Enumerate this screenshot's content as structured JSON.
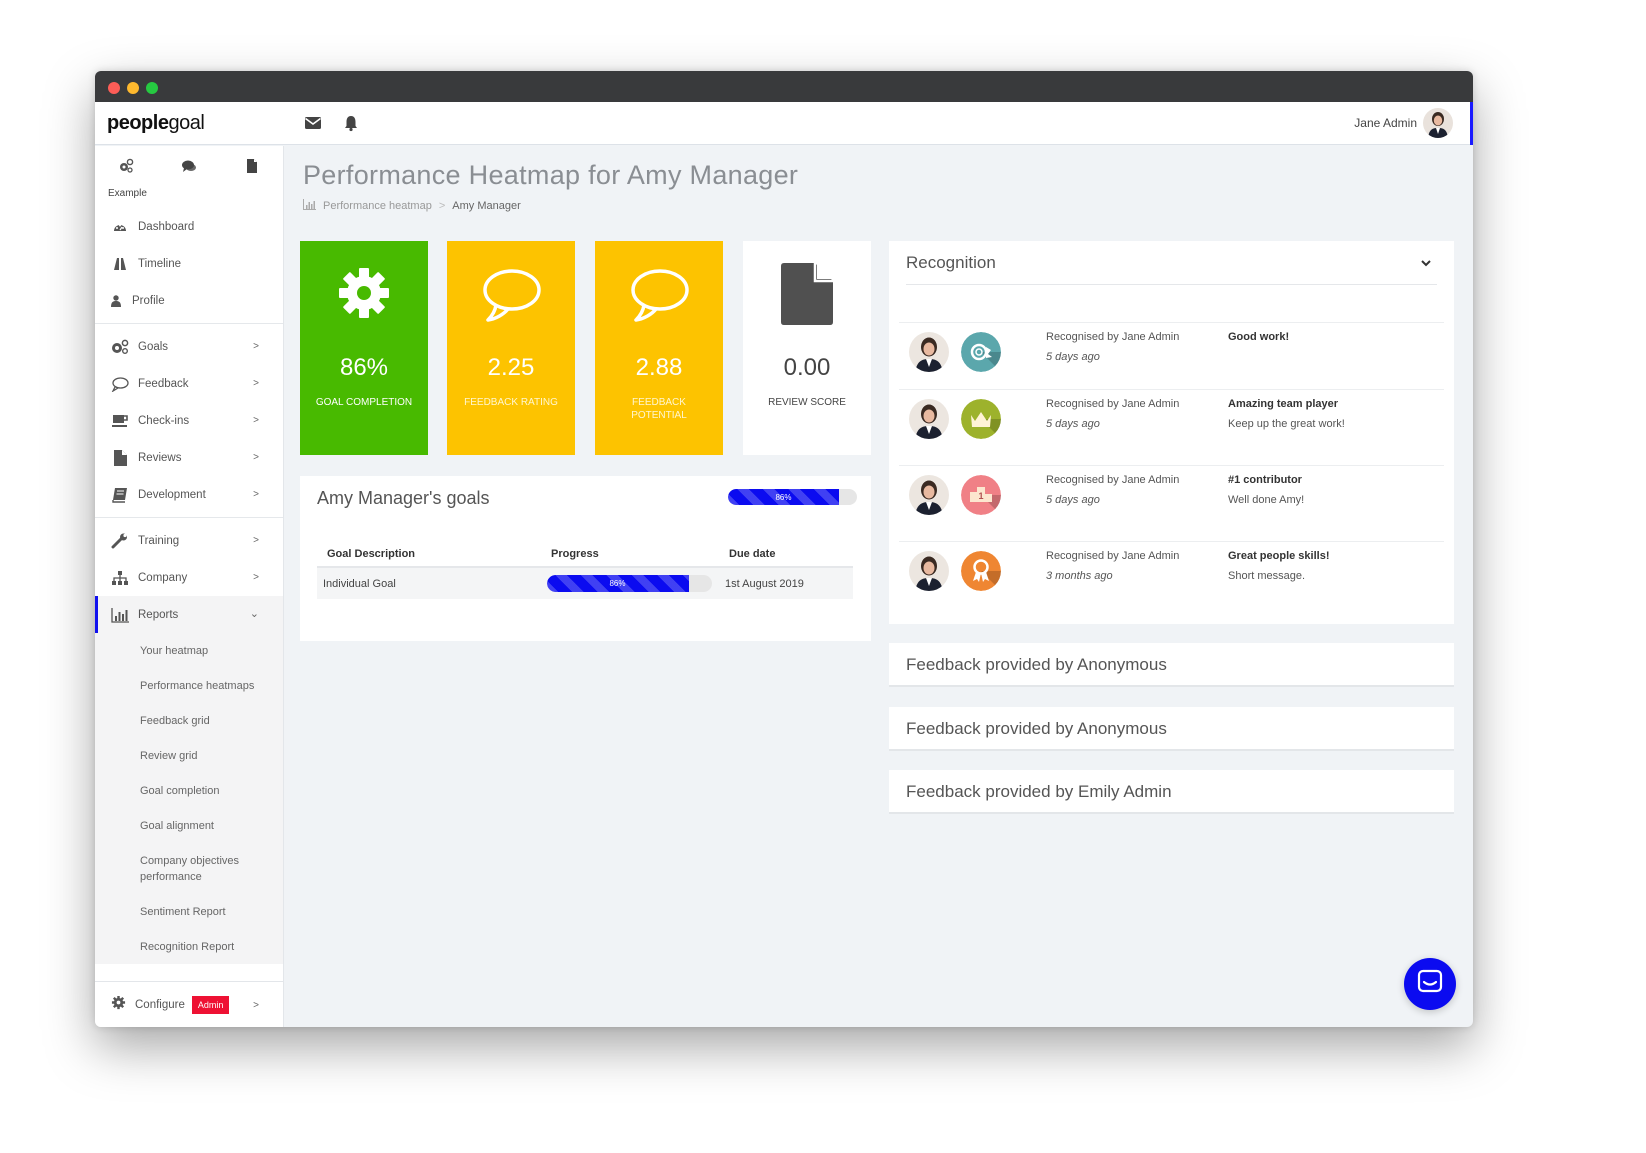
{
  "app": {
    "logo_bold": "people",
    "logo_light": "goal",
    "user_name": "Jane Admin"
  },
  "sidebar": {
    "org_label": "Example",
    "top_items": [
      {
        "label": "Dashboard",
        "icon": "dashboard-icon"
      },
      {
        "label": "Timeline",
        "icon": "road-icon"
      },
      {
        "label": "Profile",
        "icon": "user-icon"
      }
    ],
    "section_items": [
      {
        "label": "Goals",
        "icon": "cogs-icon"
      },
      {
        "label": "Feedback",
        "icon": "speech-bubble-icon"
      },
      {
        "label": "Check-ins",
        "icon": "coffee-cup-icon"
      },
      {
        "label": "Reviews",
        "icon": "document-icon"
      },
      {
        "label": "Development",
        "icon": "book-icon"
      }
    ],
    "lower_items": [
      {
        "label": "Training",
        "icon": "wrench-icon"
      },
      {
        "label": "Company",
        "icon": "org-chart-icon"
      }
    ],
    "reports": {
      "label": "Reports",
      "sub_items": [
        "Your heatmap",
        "Performance heatmaps",
        "Feedback grid",
        "Review grid",
        "Goal completion",
        "Goal alignment",
        "Company objectives performance",
        "Sentiment Report",
        "Recognition Report"
      ]
    },
    "configure": {
      "label": "Configure",
      "badge": "Admin"
    }
  },
  "page": {
    "title": "Performance Heatmap for Amy Manager",
    "breadcrumb": {
      "parent": "Performance heatmap",
      "separator": ">",
      "current": "Amy Manager"
    }
  },
  "tiles": [
    {
      "value": "86%",
      "label": "GOAL COMPLETION",
      "color": "#48ba00",
      "icon": "gear-icon"
    },
    {
      "value": "2.25",
      "label": "FEEDBACK RATING",
      "color": "#fdc300",
      "icon": "speech-bubble-icon"
    },
    {
      "value": "2.88",
      "label": "FEEDBACK POTENTIAL",
      "color": "#fdc300",
      "icon": "speech-bubble-icon"
    },
    {
      "value": "0.00",
      "label": "REVIEW SCORE",
      "color": "#ffffff",
      "icon": "document-icon"
    }
  ],
  "goals": {
    "title": "Amy Manager's goals",
    "overall_progress": 86,
    "overall_progress_label": "86%",
    "columns": [
      "Goal Description",
      "Progress",
      "Due date"
    ],
    "rows": [
      {
        "description": "Individual Goal",
        "progress": 86,
        "progress_label": "86%",
        "due": "1st August 2019"
      }
    ]
  },
  "recognition": {
    "title": "Recognition",
    "items": [
      {
        "by": "Recognised by Jane Admin",
        "when": "5 days ago",
        "title": "Good work!",
        "message": "",
        "badge": "gear-badge-icon",
        "badge_color": "#5ba7ac"
      },
      {
        "by": "Recognised by Jane Admin",
        "when": "5 days ago",
        "title": "Amazing team player",
        "message": "Keep up the great work!",
        "badge": "crown-badge-icon",
        "badge_color": "#9db22c"
      },
      {
        "by": "Recognised by Jane Admin",
        "when": "5 days ago",
        "title": "#1 contributor",
        "message": "Well done Amy!",
        "badge": "podium-badge-icon",
        "badge_color": "#f08086"
      },
      {
        "by": "Recognised by Jane Admin",
        "when": "3 months ago",
        "title": "Great people skills!",
        "message": "Short message.",
        "badge": "ribbon-badge-icon",
        "badge_color": "#ef8632"
      }
    ]
  },
  "feedback_cards": [
    "Feedback provided by Anonymous",
    "Feedback provided by Anonymous",
    "Feedback provided by Emily Admin"
  ],
  "colors": {
    "accent": "#0b0bf0",
    "green": "#48ba00",
    "yellow": "#fdc300",
    "admin_badge": "#ee1133"
  }
}
